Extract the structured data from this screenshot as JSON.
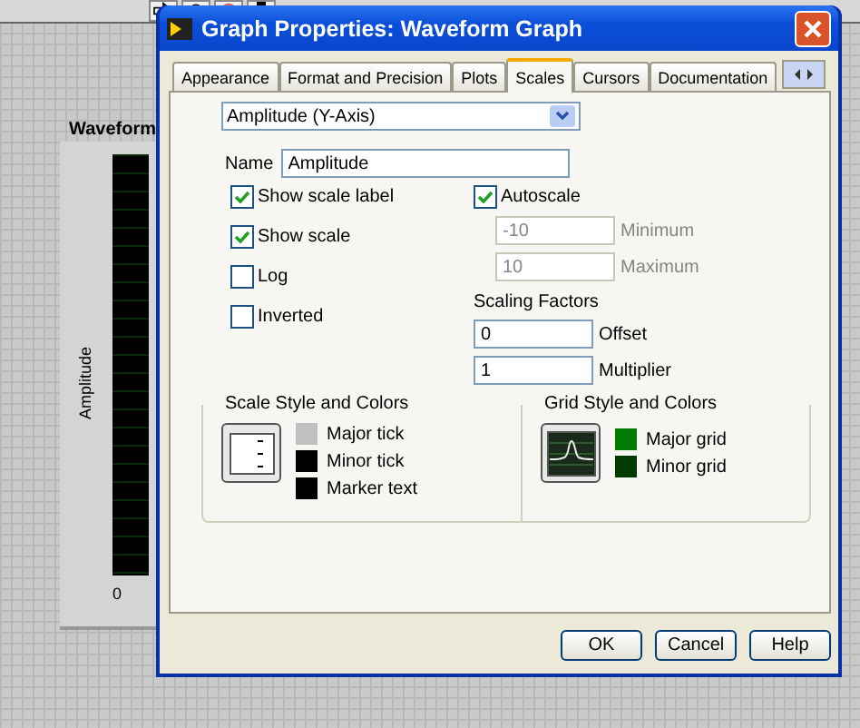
{
  "graph": {
    "label": "Waveform",
    "axis_label": "Amplitude",
    "tick": "0"
  },
  "dialog": {
    "title": "Graph Properties: Waveform Graph",
    "tabs": [
      {
        "label": "Appearance",
        "selected": false
      },
      {
        "label": "Format and Precision",
        "selected": false
      },
      {
        "label": "Plots",
        "selected": false
      },
      {
        "label": "Scales",
        "selected": true
      },
      {
        "label": "Cursors",
        "selected": false
      },
      {
        "label": "Documentation",
        "selected": false
      }
    ],
    "axis_select": {
      "value": "Amplitude (Y-Axis)"
    },
    "name": {
      "label": "Name",
      "value": "Amplitude"
    },
    "options": [
      {
        "label": "Show scale label",
        "checked": true
      },
      {
        "label": "Show scale",
        "checked": true
      },
      {
        "label": "Log",
        "checked": false
      },
      {
        "label": "Inverted",
        "checked": false
      }
    ],
    "autoscale": {
      "label": "Autoscale",
      "checked": true
    },
    "range": [
      {
        "value": "-10",
        "label": "Minimum",
        "disabled": true
      },
      {
        "value": "10",
        "label": "Maximum",
        "disabled": true
      }
    ],
    "scaling": {
      "title": "Scaling Factors",
      "fields": [
        {
          "value": "0",
          "label": "Offset"
        },
        {
          "value": "1",
          "label": "Multiplier"
        }
      ]
    },
    "scale_style": {
      "title": "Scale Style and Colors",
      "colors": [
        {
          "label": "Major tick",
          "color": "#c0c0c0"
        },
        {
          "label": "Minor tick",
          "color": "#000000"
        },
        {
          "label": "Marker text",
          "color": "#000000"
        }
      ]
    },
    "grid_style": {
      "title": "Grid Style and Colors",
      "colors": [
        {
          "label": "Major grid",
          "color": "#007a00"
        },
        {
          "label": "Minor grid",
          "color": "#003a00"
        }
      ]
    },
    "buttons": [
      "OK",
      "Cancel",
      "Help"
    ]
  }
}
